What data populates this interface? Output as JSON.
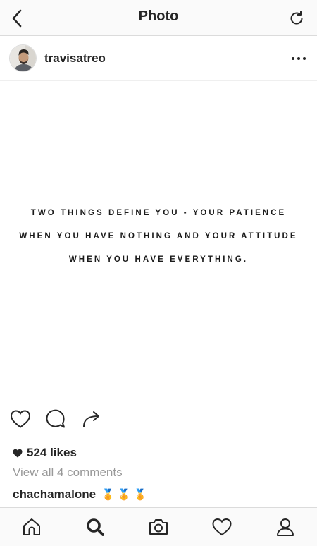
{
  "nav": {
    "title": "Photo",
    "back_icon": "chevron-left-icon",
    "refresh_icon": "refresh-icon"
  },
  "post": {
    "username": "travisatreo",
    "avatar_icon": "avatar-photo",
    "more_icon": "more-horizontal-icon",
    "quote_lines": [
      "TWO THINGS DEFINE YOU - YOUR PATIENCE",
      "WHEN YOU HAVE NOTHING AND YOUR ATTITUDE",
      "WHEN YOU HAVE EVERYTHING."
    ],
    "likes_text": "524 likes",
    "view_comments_text": "View all 4 comments",
    "comment": {
      "user": "chachamalone",
      "text": "🏅🏅🏅"
    }
  },
  "actions": {
    "like_icon": "heart-outline-icon",
    "comment_icon": "comment-bubble-icon",
    "share_icon": "share-arrow-icon"
  },
  "tab_bar": {
    "items": [
      "home-icon",
      "search-icon",
      "camera-icon",
      "activity-heart-icon",
      "profile-icon"
    ],
    "active": "search-icon"
  },
  "colors": {
    "text": "#262626",
    "muted": "#999999",
    "border": "#dbdbdb",
    "bar_bg": "#fafafa"
  }
}
